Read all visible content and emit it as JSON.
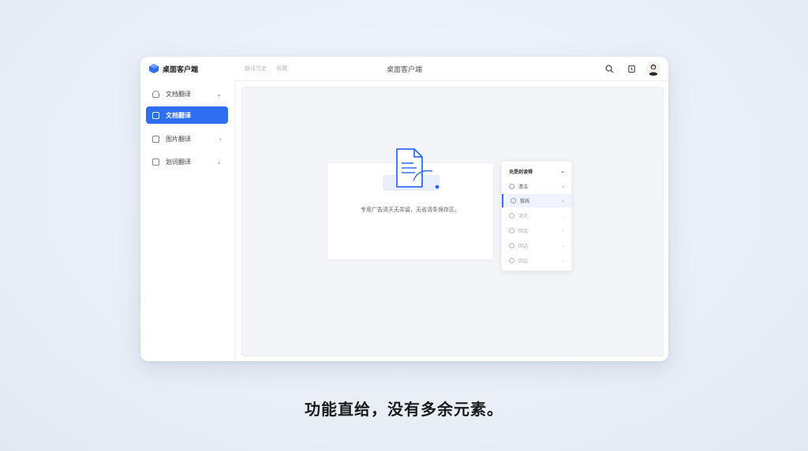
{
  "app": {
    "name": "桌面客户端",
    "center_title": "桌面客户端",
    "breadcrumb": [
      "翻译历史",
      "收藏"
    ]
  },
  "toolbar": {
    "icons": [
      "search-icon",
      "history-icon",
      "user-avatar"
    ]
  },
  "sidebar": {
    "items": [
      {
        "label": "文档翻译",
        "icon": "file-icon",
        "chevron": "⌄",
        "active": false
      },
      {
        "label": "文档翻译",
        "icon": "document-icon",
        "chevron": "",
        "active": true
      },
      {
        "label": "图片翻译",
        "icon": "image-icon",
        "chevron": "›",
        "active": false
      },
      {
        "label": "划词翻译",
        "icon": "text-icon",
        "chevron": "⌄",
        "active": false
      }
    ]
  },
  "main": {
    "card_text": "专用广告清天无并留，无省清条保存区。"
  },
  "dropdown": {
    "header": "充是则读得",
    "items": [
      {
        "label": "清洁",
        "state": "normal"
      },
      {
        "label": "拔线",
        "state": "selected"
      },
      {
        "label": "消灭",
        "state": "dim"
      },
      {
        "label": "回话",
        "state": "dim"
      },
      {
        "label": "回话",
        "state": "dim"
      },
      {
        "label": "回话",
        "state": "dim"
      }
    ]
  },
  "caption": "功能直给，没有多余元素。",
  "colors": {
    "accent": "#2f6ef0",
    "background": "#e9eef7"
  }
}
